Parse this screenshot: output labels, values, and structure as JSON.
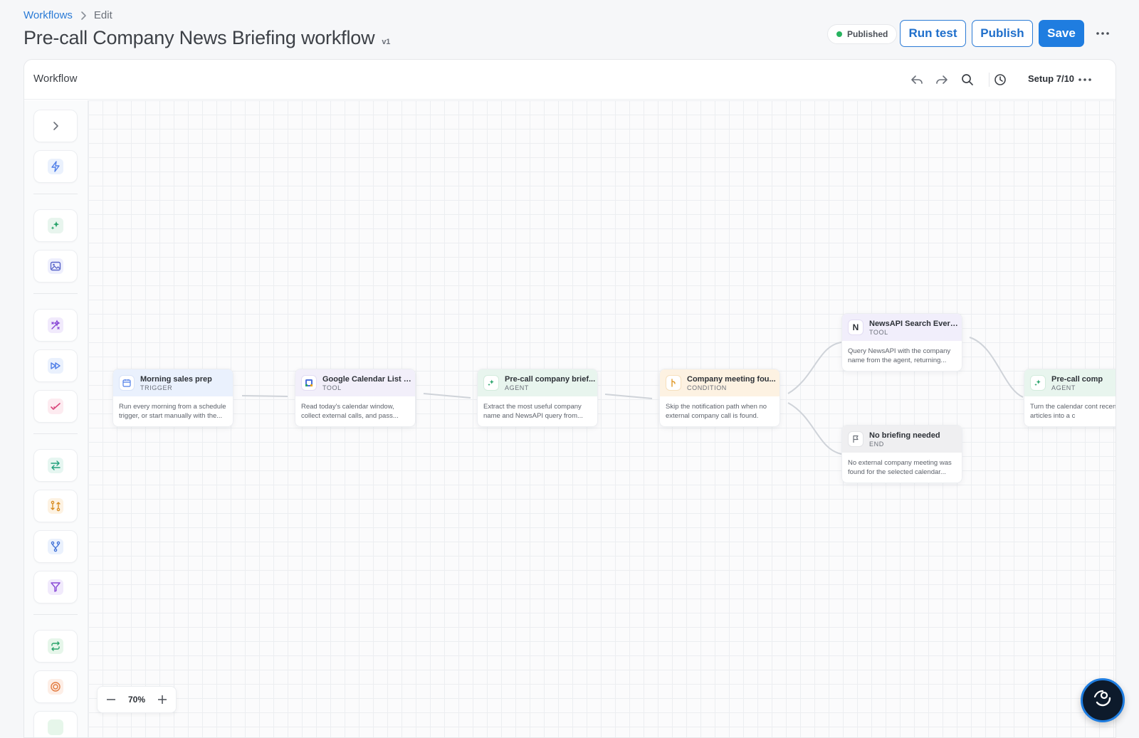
{
  "breadcrumb": {
    "parent": "Workflows",
    "current": "Edit"
  },
  "page": {
    "title": "Pre-call Company News Briefing workflow",
    "version": "v1"
  },
  "status": {
    "label": "Published",
    "color": "#27b35f"
  },
  "actions": {
    "run_test": "Run test",
    "publish": "Publish",
    "save": "Save"
  },
  "panel": {
    "title": "Workflow",
    "setup_progress": "Setup 7/10"
  },
  "toolbar_icons": [
    "undo-icon",
    "redo-icon",
    "search-icon",
    "history-icon",
    "more-icon"
  ],
  "sidebar": {
    "items": [
      {
        "icon": "expand-chevron-icon"
      },
      {
        "icon": "lightning-trigger-icon"
      },
      {
        "icon": "sparkle-agent-icon"
      },
      {
        "icon": "image-icon"
      },
      {
        "icon": "magic-tools-icon"
      },
      {
        "icon": "fast-forward-icon"
      },
      {
        "icon": "checkmark-icon"
      },
      {
        "icon": "swap-arrows-icon"
      },
      {
        "icon": "git-compare-icon"
      },
      {
        "icon": "branch-icon"
      },
      {
        "icon": "filter-icon"
      },
      {
        "icon": "loop-icon"
      },
      {
        "icon": "target-icon"
      }
    ]
  },
  "nodes": [
    {
      "title": "Morning sales prep",
      "type": "TRIGGER",
      "desc": "Run every morning from a schedule trigger, or start manually with the...",
      "icon": "calendar-icon",
      "color": "#4f7ee8",
      "head_bg": "#eaf1fd"
    },
    {
      "title": "Google Calendar List E...",
      "type": "TOOL",
      "desc": "Read today's calendar window, collect external calls, and pass...",
      "icon": "google-calendar-icon",
      "color": "#4a6fd8",
      "head_bg": "#f2effa"
    },
    {
      "title": "Pre-call company brief...",
      "type": "AGENT",
      "desc": "Extract the most useful company name and NewsAPI query from...",
      "icon": "sparkle-agent-icon",
      "color": "#2aa36b",
      "head_bg": "#e8f5ee"
    },
    {
      "title": "Company meeting fou...",
      "type": "CONDITION",
      "desc": "Skip the notification path when no external company call is found.",
      "icon": "condition-branch-icon",
      "color": "#e09a2b",
      "head_bg": "#fdf2e2"
    },
    {
      "title": "NewsAPI Search Every...",
      "type": "TOOL",
      "desc": "Query NewsAPI with the company name from the agent, returning...",
      "icon": "newsapi-logo-icon",
      "color": "#2d3137",
      "head_bg": "#f1eefb"
    },
    {
      "title": "No briefing needed",
      "type": "END",
      "desc": "No external company meeting was found for the selected calendar...",
      "icon": "flag-icon",
      "color": "#6b7079",
      "head_bg": "#efeff1"
    },
    {
      "title": "Pre-call comp",
      "type": "AGENT",
      "desc": "Turn the calendar cont recent articles into a c",
      "icon": "sparkle-agent-icon",
      "color": "#2aa36b",
      "head_bg": "#e8f5ee"
    }
  ],
  "zoom": {
    "minus": "−",
    "value": "70%",
    "plus": "+"
  },
  "colors": {
    "accent": "#1f7de0",
    "link": "#2b7bd6"
  }
}
